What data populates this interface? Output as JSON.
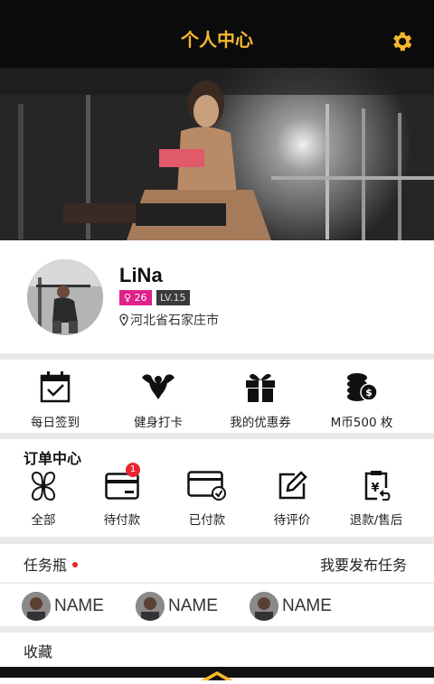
{
  "header": {
    "title": "个人中心",
    "settings_icon": "gear-icon",
    "accent": "#f5b82e"
  },
  "profile": {
    "name": "LiNa",
    "gender_age": "♀ 26",
    "level": "LV.15",
    "location": "河北省石家庄市"
  },
  "quick_actions": [
    {
      "label": "每日签到",
      "icon": "calendar-check-icon"
    },
    {
      "label": "健身打卡",
      "icon": "muscle-icon"
    },
    {
      "label": "我的优惠券",
      "icon": "gift-icon"
    },
    {
      "label": "M币500 枚",
      "icon": "coins-icon"
    }
  ],
  "orders": {
    "title": "订单中心",
    "items": [
      {
        "label": "全部",
        "icon": "clover-icon"
      },
      {
        "label": "待付款",
        "icon": "card-icon",
        "badge": "1"
      },
      {
        "label": "已付款",
        "icon": "card-paid-icon"
      },
      {
        "label": "待评价",
        "icon": "edit-icon"
      },
      {
        "label": "退款/售后",
        "icon": "refund-icon"
      }
    ]
  },
  "tasks": {
    "title": "任务瓶",
    "publish_label": "我要发布任务"
  },
  "users": [
    {
      "name": "NAME"
    },
    {
      "name": "NAME"
    },
    {
      "name": "NAME"
    }
  ],
  "favorites": {
    "title": "收藏"
  }
}
